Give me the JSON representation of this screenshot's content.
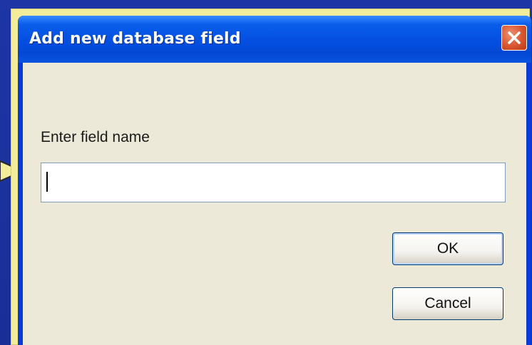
{
  "dialog": {
    "title": "Add new database field",
    "prompt": "Enter field name",
    "field": {
      "value": "",
      "placeholder": ""
    },
    "ok_label": "OK",
    "cancel_label": "Cancel",
    "close_icon": "close-icon"
  },
  "colors": {
    "titlebar": "#0550e2",
    "client_background": "#ece9d8",
    "close_button": "#d9552f",
    "highlight_outline": "#f3ec9a",
    "desktop": "#1a2f9a"
  }
}
